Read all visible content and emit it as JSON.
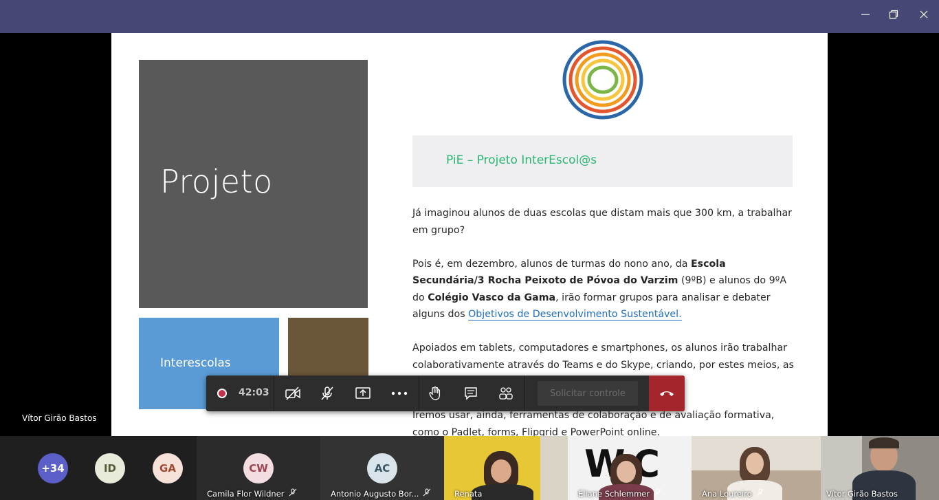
{
  "slide": {
    "tile_big_text": "Projeto",
    "tile_blue_text": "Interescolas",
    "header": "PiE – Projeto InterEscol@s",
    "p1": "Já imaginou alunos de duas escolas que distam mais que 300 km, a trabalhar em grupo?",
    "p2_a": "Pois é, em dezembro, alunos de turmas do nono ano, da ",
    "p2_b": "Escola Secundária/3 Rocha Peixoto de Póvoa do Varzim",
    "p2_c": " (9ºB) e alunos do 9ºA do ",
    "p2_d": "Colégio Vasco da Gama",
    "p2_e": ", irão formar grupos para analisar e debater alguns dos ",
    "p2_link": "Objetivos de Desenvolvimento Sustentável.",
    "p3": "Apoiados em tablets, computadores e smartphones, os alunos irão trabalhar colaborativamente através do Teams e do Skype, criando, por estes meios, as equipas de trabalho.",
    "p4": "Iremos usar, ainda, ferramentas de colaboração e de avaliação formativa, como o Padlet, forms, Flipgrid e PowerPoint online."
  },
  "presenter_name": "Vítor Girão Bastos",
  "controls": {
    "timer": "42:03",
    "request_control": "Solicitar controle"
  },
  "participants": {
    "overflow": "+34",
    "avatars": [
      {
        "initials": "ID",
        "bg": "#e8ebd9",
        "fg": "#555a3a"
      },
      {
        "initials": "GA",
        "bg": "#f6e1d9",
        "fg": "#a04a33"
      },
      {
        "initials": "CW",
        "bg": "#f4dde0",
        "fg": "#9c4451"
      },
      {
        "initials": "AC",
        "bg": "#d8e4ea",
        "fg": "#3d5563"
      }
    ],
    "names": {
      "camila": "Camila Flor Wildner",
      "antonio": "Antonio Augusto Bor...",
      "renata": "Renata",
      "eliane": "Eliane Schlemmer",
      "ana": "Ana Loureiro",
      "vitor": "Vítor Girão Bastos"
    }
  },
  "colors": {
    "titlebar": "#464775",
    "accent_green": "#2bb673",
    "hangup": "#a4262c"
  }
}
